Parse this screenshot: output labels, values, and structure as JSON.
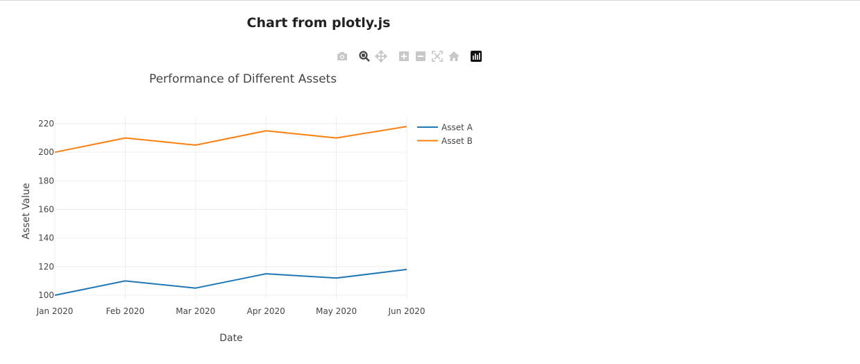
{
  "page": {
    "heading": "Chart from plotly.js"
  },
  "modebar": {
    "buttons": [
      {
        "name": "download-plot-as-png",
        "icon": "camera-icon"
      },
      {
        "name": "zoom",
        "icon": "zoom-icon",
        "active": true
      },
      {
        "name": "pan",
        "icon": "pan-icon"
      },
      {
        "name": "zoom-in",
        "icon": "zoom-in-icon"
      },
      {
        "name": "zoom-out",
        "icon": "zoom-out-icon"
      },
      {
        "name": "autoscale",
        "icon": "autoscale-icon"
      },
      {
        "name": "reset-axes",
        "icon": "home-icon"
      },
      {
        "name": "plotly-logo",
        "icon": "plotly-logo-icon"
      }
    ]
  },
  "chart_data": {
    "type": "line",
    "title": "Performance of Different Assets",
    "xlabel": "Date",
    "ylabel": "Asset Value",
    "x": [
      "Jan 2020",
      "Feb 2020",
      "Mar 2020",
      "Apr 2020",
      "May 2020",
      "Jun 2020"
    ],
    "xticks": [
      "Jan 2020",
      "Feb 2020",
      "Mar 2020",
      "Apr 2020",
      "May 2020",
      "Jun 2020"
    ],
    "yticks": [
      100,
      120,
      140,
      160,
      180,
      200,
      220
    ],
    "ylim": [
      98,
      223
    ],
    "grid": true,
    "legend_position": "top-right (outside plot)",
    "series": [
      {
        "name": "Asset A",
        "color": "#1f77b4",
        "values": [
          100,
          110,
          105,
          115,
          112,
          118
        ]
      },
      {
        "name": "Asset B",
        "color": "#ff7f0e",
        "values": [
          200,
          210,
          205,
          215,
          210,
          218
        ]
      }
    ]
  }
}
